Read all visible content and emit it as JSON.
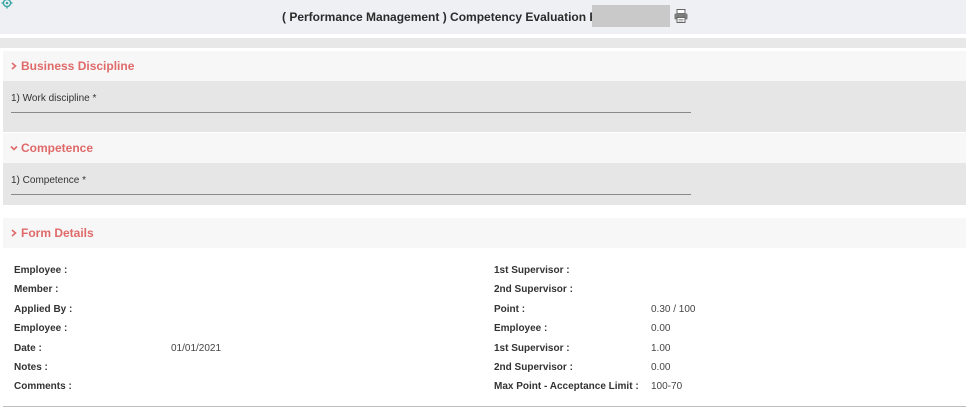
{
  "header": {
    "title": "( Performance Management ) Competency Evaluation Form 2",
    "icons": {
      "settings": "gear-icon",
      "print": "printer-icon"
    }
  },
  "sections": {
    "business_discipline": {
      "title": "Business Discipline",
      "chevron": "chevron-right-icon",
      "question": "1) Work discipline *"
    },
    "competence": {
      "title": "Competence",
      "chevron": "chevron-down-icon",
      "question": "1) Competence *"
    },
    "form_details": {
      "title": "Form Details",
      "chevron": "chevron-right-icon"
    }
  },
  "details": {
    "left": [
      {
        "label": "Employee :",
        "value": ""
      },
      {
        "label": "Member :",
        "value": ""
      },
      {
        "label": "Applied By :",
        "value": ""
      },
      {
        "label": "Employee :",
        "value": ""
      },
      {
        "label": "Date :",
        "value": "01/01/2021"
      },
      {
        "label": "Notes :",
        "value": ""
      },
      {
        "label": "Comments :",
        "value": ""
      }
    ],
    "right": [
      {
        "label": "1st Supervisor :",
        "value": ""
      },
      {
        "label": "2nd Supervisor :",
        "value": ""
      },
      {
        "label": "Point :",
        "value": "0.30 / 100"
      },
      {
        "label": "Employee :",
        "value": "0.00"
      },
      {
        "label": "1st Supervisor :",
        "value": "1.00"
      },
      {
        "label": "2nd Supervisor :",
        "value": "0.00"
      },
      {
        "label": "Max Point - Acceptance Limit :",
        "value": "100-70"
      }
    ]
  },
  "colors": {
    "section_title": "#e06a6a",
    "header_bg": "#eef0f4",
    "section_body_bg": "#e6e6e6"
  }
}
